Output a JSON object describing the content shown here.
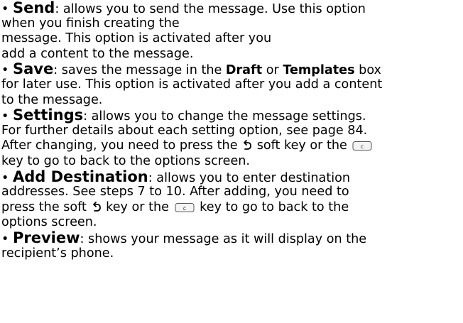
{
  "items": [
    {
      "term": "Send",
      "lines": [
        "when you finish creating the",
        "message. This option is activated after you",
        "add a content to the message."
      ],
      "first_tail": ": allows you to send the message. Use this option"
    },
    {
      "term": "Save",
      "first_tail_a": ": saves the message in the ",
      "bold_1": "Draft",
      "first_tail_b": " or ",
      "bold_2": "Templates",
      "first_tail_c": " box",
      "lines": [
        "for later use. This option is activated after you add a content",
        "to the message."
      ]
    },
    {
      "term": "Settings",
      "first_tail": ": allows you to change the message settings.",
      "line2": "For further details about each setting option, see page 84.",
      "line3_a": "After changing, you need to press the ",
      "line3_b": " soft key or the ",
      "line4": "key to go to back to the options screen."
    },
    {
      "term": "Add Destination",
      "first_tail": ": allows you to enter destination",
      "line2": "addresses. See steps 7 to 10. After adding, you need to",
      "line3_a": "press the soft ",
      "line3_b": " key or the ",
      "line3_c": " key to go to back to the",
      "line4": "options screen."
    },
    {
      "term": "Preview",
      "first_tail": ": shows your message as it will display on the",
      "line2": "recipient’s phone."
    }
  ],
  "bullet": "•",
  "key_label": "c",
  "icons": [
    "back-arrow-icon",
    "clear-key-icon"
  ]
}
